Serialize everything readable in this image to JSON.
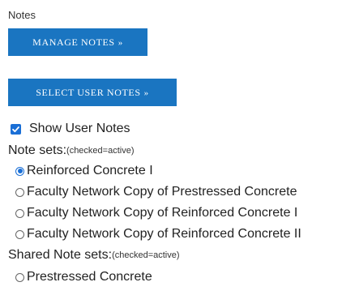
{
  "notes": {
    "section_title": "Notes",
    "manage_button": "MANAGE NOTES",
    "select_button": "SELECT USER NOTES",
    "button_arrow": "»",
    "show_user_notes": {
      "label": "Show User Notes",
      "checked": true
    },
    "note_sets": {
      "label": "Note sets:",
      "hint": "(checked=active)",
      "items": [
        {
          "label": "Reinforced Concrete I",
          "checked": true
        },
        {
          "label": "Faculty Network Copy of Prestressed Concrete",
          "checked": false
        },
        {
          "label": "Faculty Network Copy of Reinforced Concrete I",
          "checked": false
        },
        {
          "label": "Faculty Network Copy of Reinforced Concrete II",
          "checked": false
        }
      ]
    },
    "shared_note_sets": {
      "label": "Shared Note sets:",
      "hint": "(checked=active)",
      "items": [
        {
          "label": "Prestressed Concrete",
          "checked": false
        }
      ]
    }
  },
  "colors": {
    "button_bg": "#1a75c1",
    "accent": "#1a6fd6"
  }
}
